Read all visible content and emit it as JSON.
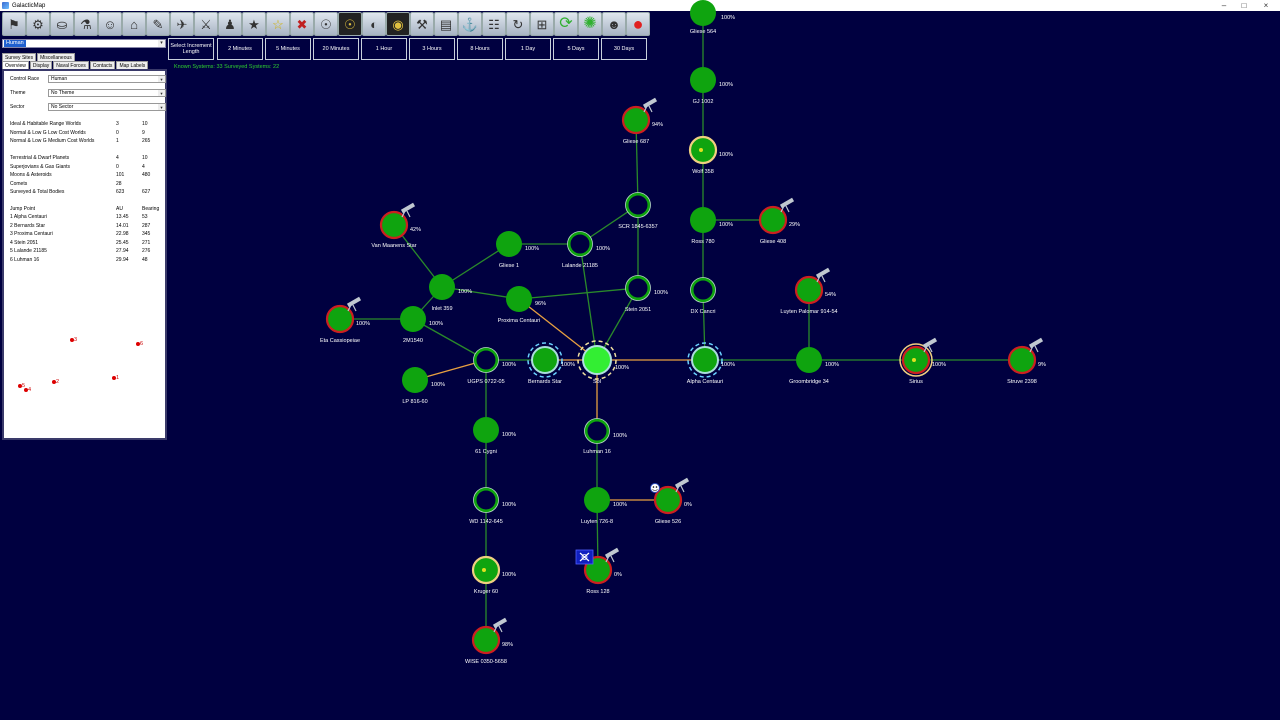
{
  "window": {
    "title": "GalacticMap"
  },
  "race_selector": {
    "value": "Human"
  },
  "tabs_row1": [
    "Survey Sites",
    "Miscellaneous"
  ],
  "tabs_row2": [
    "Overview",
    "Display",
    "Naval Forces",
    "Contacts",
    "Map Labels"
  ],
  "time": {
    "select_label": "Select Increment Length",
    "buttons": [
      "2 Minutes",
      "5 Minutes",
      "20 Minutes",
      "1 Hour",
      "3 Hours",
      "8 Hours",
      "1 Day",
      "5 Days",
      "30 Days"
    ]
  },
  "known_systems": "Known Systems: 33   Surveyed Systems: 22",
  "overview": {
    "control_race_label": "Control Race",
    "control_race": "Human",
    "theme_label": "Theme",
    "theme": "No Theme",
    "sector_label": "Sector",
    "sector": "No Sector",
    "stats1": [
      {
        "label": "Ideal & Habitable Range Worlds",
        "a": "3",
        "b": "10"
      },
      {
        "label": "Normal & Low G Low Cost Worlds",
        "a": "0",
        "b": "9"
      },
      {
        "label": "Normal & Low G Medium Cost Worlds",
        "a": "1",
        "b": "265"
      }
    ],
    "stats2": [
      {
        "label": "Terrestrial & Dwarf Planets",
        "a": "4",
        "b": "10"
      },
      {
        "label": "Superjovians & Gas Giants",
        "a": "0",
        "b": "4"
      },
      {
        "label": "Moons & Asteroids",
        "a": "101",
        "b": "480"
      },
      {
        "label": "Comets",
        "a": "28",
        "b": ""
      },
      {
        "label": "Surveyed & Total Bodies",
        "a": "623",
        "b": "627"
      }
    ],
    "jp_header": {
      "label": "Jump Point",
      "a": "AU",
      "b": "Bearing"
    },
    "jump_points": [
      {
        "label": "1  Alpha Centauri",
        "a": "13.45",
        "b": "53"
      },
      {
        "label": "2  Bernards Star",
        "a": "14.01",
        "b": "287"
      },
      {
        "label": "3  Proxima Centauri",
        "a": "22.98",
        "b": "345"
      },
      {
        "label": "4  Stein 2051",
        "a": "25.45",
        "b": "271"
      },
      {
        "label": "5  Lalande 21185",
        "a": "27.94",
        "b": "276"
      },
      {
        "label": "6  Luhman 16",
        "a": "29.94",
        "b": "48"
      }
    ],
    "minimap_labels": [
      "3",
      "6",
      "1",
      "2",
      "5",
      "4"
    ]
  },
  "toolbar_icons": [
    "race-icon",
    "industry-icon",
    "economics-icon",
    "research-icon",
    "population-icon",
    "colony-icon",
    "design-icon",
    "fleet-icon",
    "ground-forces-icon",
    "commanders-icon",
    "medals-icon",
    "star-icon",
    "uk-flag-icon",
    "system-view-icon",
    "galactic-map-icon",
    "habitable-icon",
    "intelligence-icon",
    "mine-icon",
    "ship-class-icon",
    "turret-icon",
    "events-icon",
    "refresh-icon",
    "grid-icon",
    "green-cycle-icon",
    "green-burst-icon",
    "user-icon",
    "red-stop-icon"
  ],
  "systems": [
    {
      "name": "Gliese 564",
      "pct": "100%"
    },
    {
      "name": "GJ 1002",
      "pct": "100%"
    },
    {
      "name": "Gliese 687",
      "pct": "94%"
    },
    {
      "name": "Wolf 358",
      "pct": "100%"
    },
    {
      "name": "SCR 1845-6357",
      "pct": ""
    },
    {
      "name": "Ross 780",
      "pct": "100%"
    },
    {
      "name": "Gliese 408",
      "pct": "29%"
    },
    {
      "name": "Van Maanens Star",
      "pct": "42%"
    },
    {
      "name": "Gliese 1",
      "pct": "100%"
    },
    {
      "name": "Lalande 21185",
      "pct": "100%"
    },
    {
      "name": "Luyten Palomar 914-54",
      "pct": "54%"
    },
    {
      "name": "Inlet 359",
      "pct": "100%"
    },
    {
      "name": "Proxima Centauri",
      "pct": "96%"
    },
    {
      "name": "Stein 2051",
      "pct": "100%"
    },
    {
      "name": "DX Cancri",
      "pct": ""
    },
    {
      "name": "Eta Cassiopeiae",
      "pct": "100%"
    },
    {
      "name": "2M1540",
      "pct": "100%"
    },
    {
      "name": "UGPS 0722-05",
      "pct": "100%"
    },
    {
      "name": "Bernards Star",
      "pct": "100%"
    },
    {
      "name": "Sol",
      "pct": "100%"
    },
    {
      "name": "Alpha Centauri",
      "pct": "100%"
    },
    {
      "name": "Groombridge 34",
      "pct": "100%"
    },
    {
      "name": "Sirius",
      "pct": "100%"
    },
    {
      "name": "Struve 2398",
      "pct": "9%"
    },
    {
      "name": "LP 816-60",
      "pct": "100%"
    },
    {
      "name": "61 Cygni",
      "pct": "100%"
    },
    {
      "name": "Luhman 16",
      "pct": "100%"
    },
    {
      "name": "WD 1142-645",
      "pct": "100%"
    },
    {
      "name": "Luyten 726-8",
      "pct": "100%"
    },
    {
      "name": "Gliese 526",
      "pct": "0%"
    },
    {
      "name": "Ross 128",
      "pct": "0%"
    },
    {
      "name": "Kruger 60",
      "pct": "100%"
    },
    {
      "name": "WISE 0350-5658",
      "pct": "98%"
    }
  ],
  "colors": {
    "background": "#000040",
    "system_fill": "#0fa40f",
    "sol_fill": "#33ee33",
    "ring_red": "#cc2020",
    "ring_gold": "#f0d080",
    "link_green": "#2a8a2a",
    "link_orange": "#e8a040",
    "text_known": "#2fd22f"
  }
}
